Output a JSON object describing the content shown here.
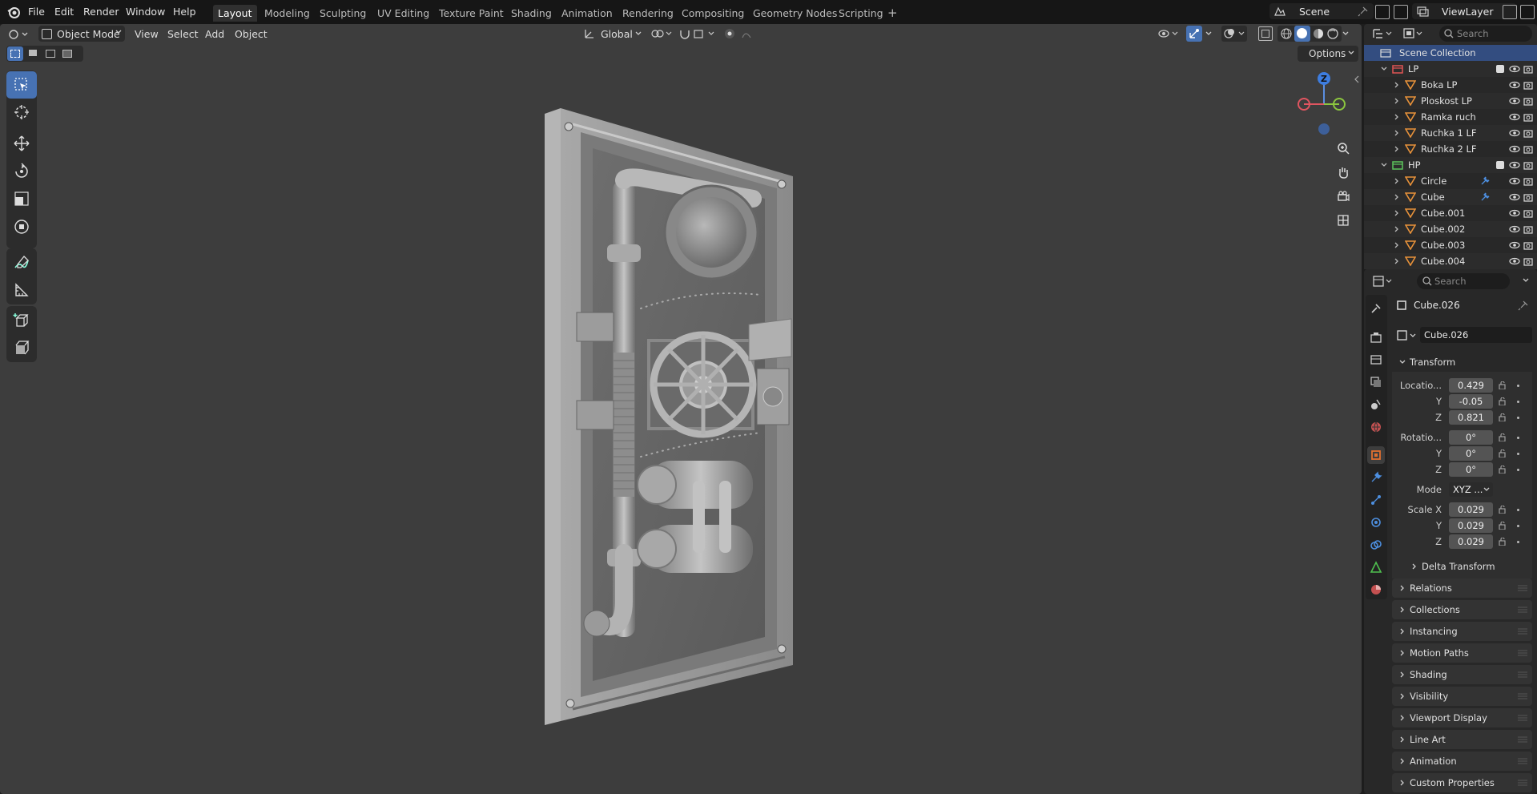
{
  "menu": {
    "file": "File",
    "edit": "Edit",
    "render": "Render",
    "window": "Window",
    "help": "Help"
  },
  "workspaces": [
    "Layout",
    "Modeling",
    "Sculpting",
    "UV Editing",
    "Texture Paint",
    "Shading",
    "Animation",
    "Rendering",
    "Compositing",
    "Geometry Nodes",
    "Scripting"
  ],
  "active_workspace": "Layout",
  "scene": {
    "name": "Scene",
    "view_layer": "ViewLayer",
    "search_placeholder": "Search"
  },
  "viewport_header": {
    "mode": "Object Mode",
    "view": "View",
    "select": "Select",
    "add": "Add",
    "object": "Object",
    "orientation": "Global",
    "options": "Options"
  },
  "gizmo": {
    "z": "Z"
  },
  "outliner": {
    "root": "Scene Collection",
    "rows": [
      {
        "name": "LP",
        "type": "collection"
      },
      {
        "name": "Boka LP",
        "type": "mesh"
      },
      {
        "name": "Ploskost LP",
        "type": "mesh"
      },
      {
        "name": "Ramka ruch",
        "type": "mesh"
      },
      {
        "name": "Ruchka 1 LF",
        "type": "mesh"
      },
      {
        "name": "Ruchka 2 LF",
        "type": "mesh"
      },
      {
        "name": "HP",
        "type": "collection"
      },
      {
        "name": "Circle",
        "type": "mesh"
      },
      {
        "name": "Cube",
        "type": "mesh"
      },
      {
        "name": "Cube.001",
        "type": "mesh"
      },
      {
        "name": "Cube.002",
        "type": "mesh"
      },
      {
        "name": "Cube.003",
        "type": "mesh"
      },
      {
        "name": "Cube.004",
        "type": "mesh"
      }
    ]
  },
  "properties": {
    "search_placeholder": "Search",
    "object_name": "Cube.026",
    "data_name": "Cube.026",
    "transform_label": "Transform",
    "location_label": "Locatio...",
    "location": {
      "x": "0.429",
      "y": "-0.05",
      "z": "0.821"
    },
    "rotation_label": "Rotatio...",
    "rotation": {
      "x": "0°",
      "y": "0°",
      "z": "0°"
    },
    "mode_label": "Mode",
    "mode_value": "XYZ ...",
    "scale_label": "Scale X",
    "scale": {
      "x": "0.029",
      "y": "0.029",
      "z": "0.029"
    },
    "axis_y": "Y",
    "axis_z": "Z",
    "delta_transform": "Delta Transform",
    "panels": [
      "Relations",
      "Collections",
      "Instancing",
      "Motion Paths",
      "Shading",
      "Visibility",
      "Viewport Display",
      "Line Art",
      "Animation",
      "Custom Properties"
    ]
  },
  "colors": {
    "accent": "#4772b3",
    "mesh_icon": "#e8923a",
    "collection_lp": "#e05555",
    "collection_hp": "#5cc55c",
    "active_tab": "#e07030"
  }
}
